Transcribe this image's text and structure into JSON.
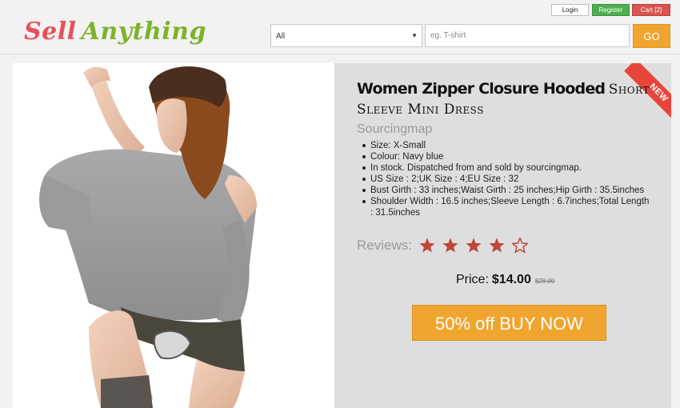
{
  "header": {
    "logo": {
      "word1": "Sell",
      "word2": "Anything"
    },
    "buttons": {
      "login": "Login",
      "register": "Register",
      "cart": "Cart [2]"
    },
    "search": {
      "category_value": "All",
      "placeholder": "eg. T-shirt",
      "go_label": "GO"
    }
  },
  "product": {
    "ribbon": "NEW",
    "title_bold": "Women Zipper Closure Hooded",
    "title_rest": "Short Sleeve Mini Dress",
    "brand": "Sourcingmap",
    "features": [
      "Size: X-Small",
      "Colour: Navy blue",
      "In stock. Dispatched from and sold by sourcingmap.",
      "US Size : 2;UK Size : 4;EU Size : 32",
      "Bust Girth : 33 inches;Waist Girth : 25 inches;Hip Girth : 35.5inches",
      "Shoulder Width : 16.5 inches;Sleeve Length : 6.7inches;Total Length : 31.5inches"
    ],
    "reviews_label": "Reviews:",
    "rating": 4,
    "rating_max": 5,
    "price_label": "Price:",
    "price": "$14.00",
    "old_price": "$28.00",
    "buy_label": "50% off BUY NOW"
  },
  "colors": {
    "logo_red": "#e8505b",
    "logo_green": "#7cb32a",
    "accent_orange": "#f0a52f",
    "star_filled": "#c0463a",
    "ribbon_red": "#e7453c"
  }
}
